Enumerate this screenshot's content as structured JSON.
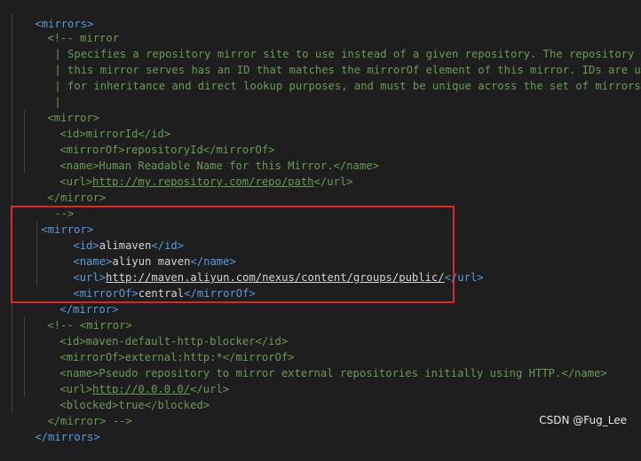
{
  "editor": {
    "lines": [
      "<mirrors>",
      "<!-- mirror",
      "| Specifies a repository mirror site to use instead of a given repository. The repository that",
      "| this mirror serves has an ID that matches the mirrorOf element of this mirror. IDs are used",
      "| for inheritance and direct lookup purposes, and must be unique across the set of mirrors.",
      "|",
      "<mirror>",
      "<id>mirrorId</id>",
      "<mirrorOf>repositoryId</mirrorOf>",
      "<name>Human Readable Name for this Mirror.</name>",
      "<url>http://my.repository.com/repo/path</url>",
      "</mirror>",
      "-->",
      "<mirror>",
      "<id>alimaven</id>",
      "<name>aliyun maven</name>",
      "<url>http://maven.aliyun.com/nexus/content/groups/public/</url>",
      "<mirrorOf>central</mirrorOf>",
      "</mirror>",
      "<!-- <mirror>",
      "<id>maven-default-http-blocker</id>",
      "<mirrorOf>external:http:*</mirrorOf>",
      "<name>Pseudo repository to mirror external repositories initially using HTTP.</name>",
      "<url>http://0.0.0.0/</url>",
      "<blocked>true</blocked>",
      "</mirror> -->",
      "</mirrors>"
    ]
  },
  "segments": {
    "l0": [
      "<mirrors>"
    ],
    "l1": [
      "<!-- mirror"
    ],
    "l2": [
      "| Specifies a repository mirror site to use instead of a given repository. The repository that"
    ],
    "l3": [
      "| this mirror serves has an ID that matches the mirrorOf element of this mirror. IDs are used"
    ],
    "l4": [
      "| for inheritance and direct lookup purposes, and must be unique across the set of mirrors."
    ],
    "l5": [
      "|"
    ],
    "l6": [
      "<mirror>"
    ],
    "l7": [
      "<id>",
      "mirrorId",
      "</id>"
    ],
    "l8": [
      "<mirrorOf>",
      "repositoryId",
      "</mirrorOf>"
    ],
    "l9": [
      "<name>",
      "Human Readable Name for this Mirror.",
      "</name>"
    ],
    "l10": [
      "<url>",
      "http://my.repository.com/repo/path",
      "</url>"
    ],
    "l11": [
      "</mirror>"
    ],
    "l12": [
      "-->"
    ],
    "l13": [
      "<mirror>"
    ],
    "l14": [
      "<id>",
      "alimaven",
      "</id>"
    ],
    "l15": [
      "<name>",
      "aliyun maven",
      "</name>"
    ],
    "l16": [
      "<url>",
      "http://maven.aliyun.com/nexus/content/groups/public/",
      "</url>"
    ],
    "l17": [
      "<mirrorOf>",
      "central",
      "</mirrorOf>"
    ],
    "l18": [
      "</mirror>"
    ],
    "l19": [
      "<!-- <mirror>"
    ],
    "l20": [
      "<id>",
      "maven-default-http-blocker",
      "</id>"
    ],
    "l21": [
      "<mirrorOf>",
      "external:http:*",
      "</mirrorOf>"
    ],
    "l22": [
      "<name>",
      "Pseudo repository to mirror external repositories initially using HTTP.",
      "</name>"
    ],
    "l23": [
      "<url>",
      "http://0.0.0.0/",
      "</url>"
    ],
    "l24": [
      "<blocked>",
      "true",
      "</blocked>"
    ],
    "l25": [
      "</mirror> -->"
    ],
    "l26": [
      "</mirrors>"
    ]
  },
  "watermark": "CSDN @Fug_Lee",
  "colors": {
    "background": "#1e1e1e",
    "tag": "#569cd6",
    "comment": "#6a9955",
    "text": "#d4d4d4",
    "highlight_border": "#e0262b"
  }
}
